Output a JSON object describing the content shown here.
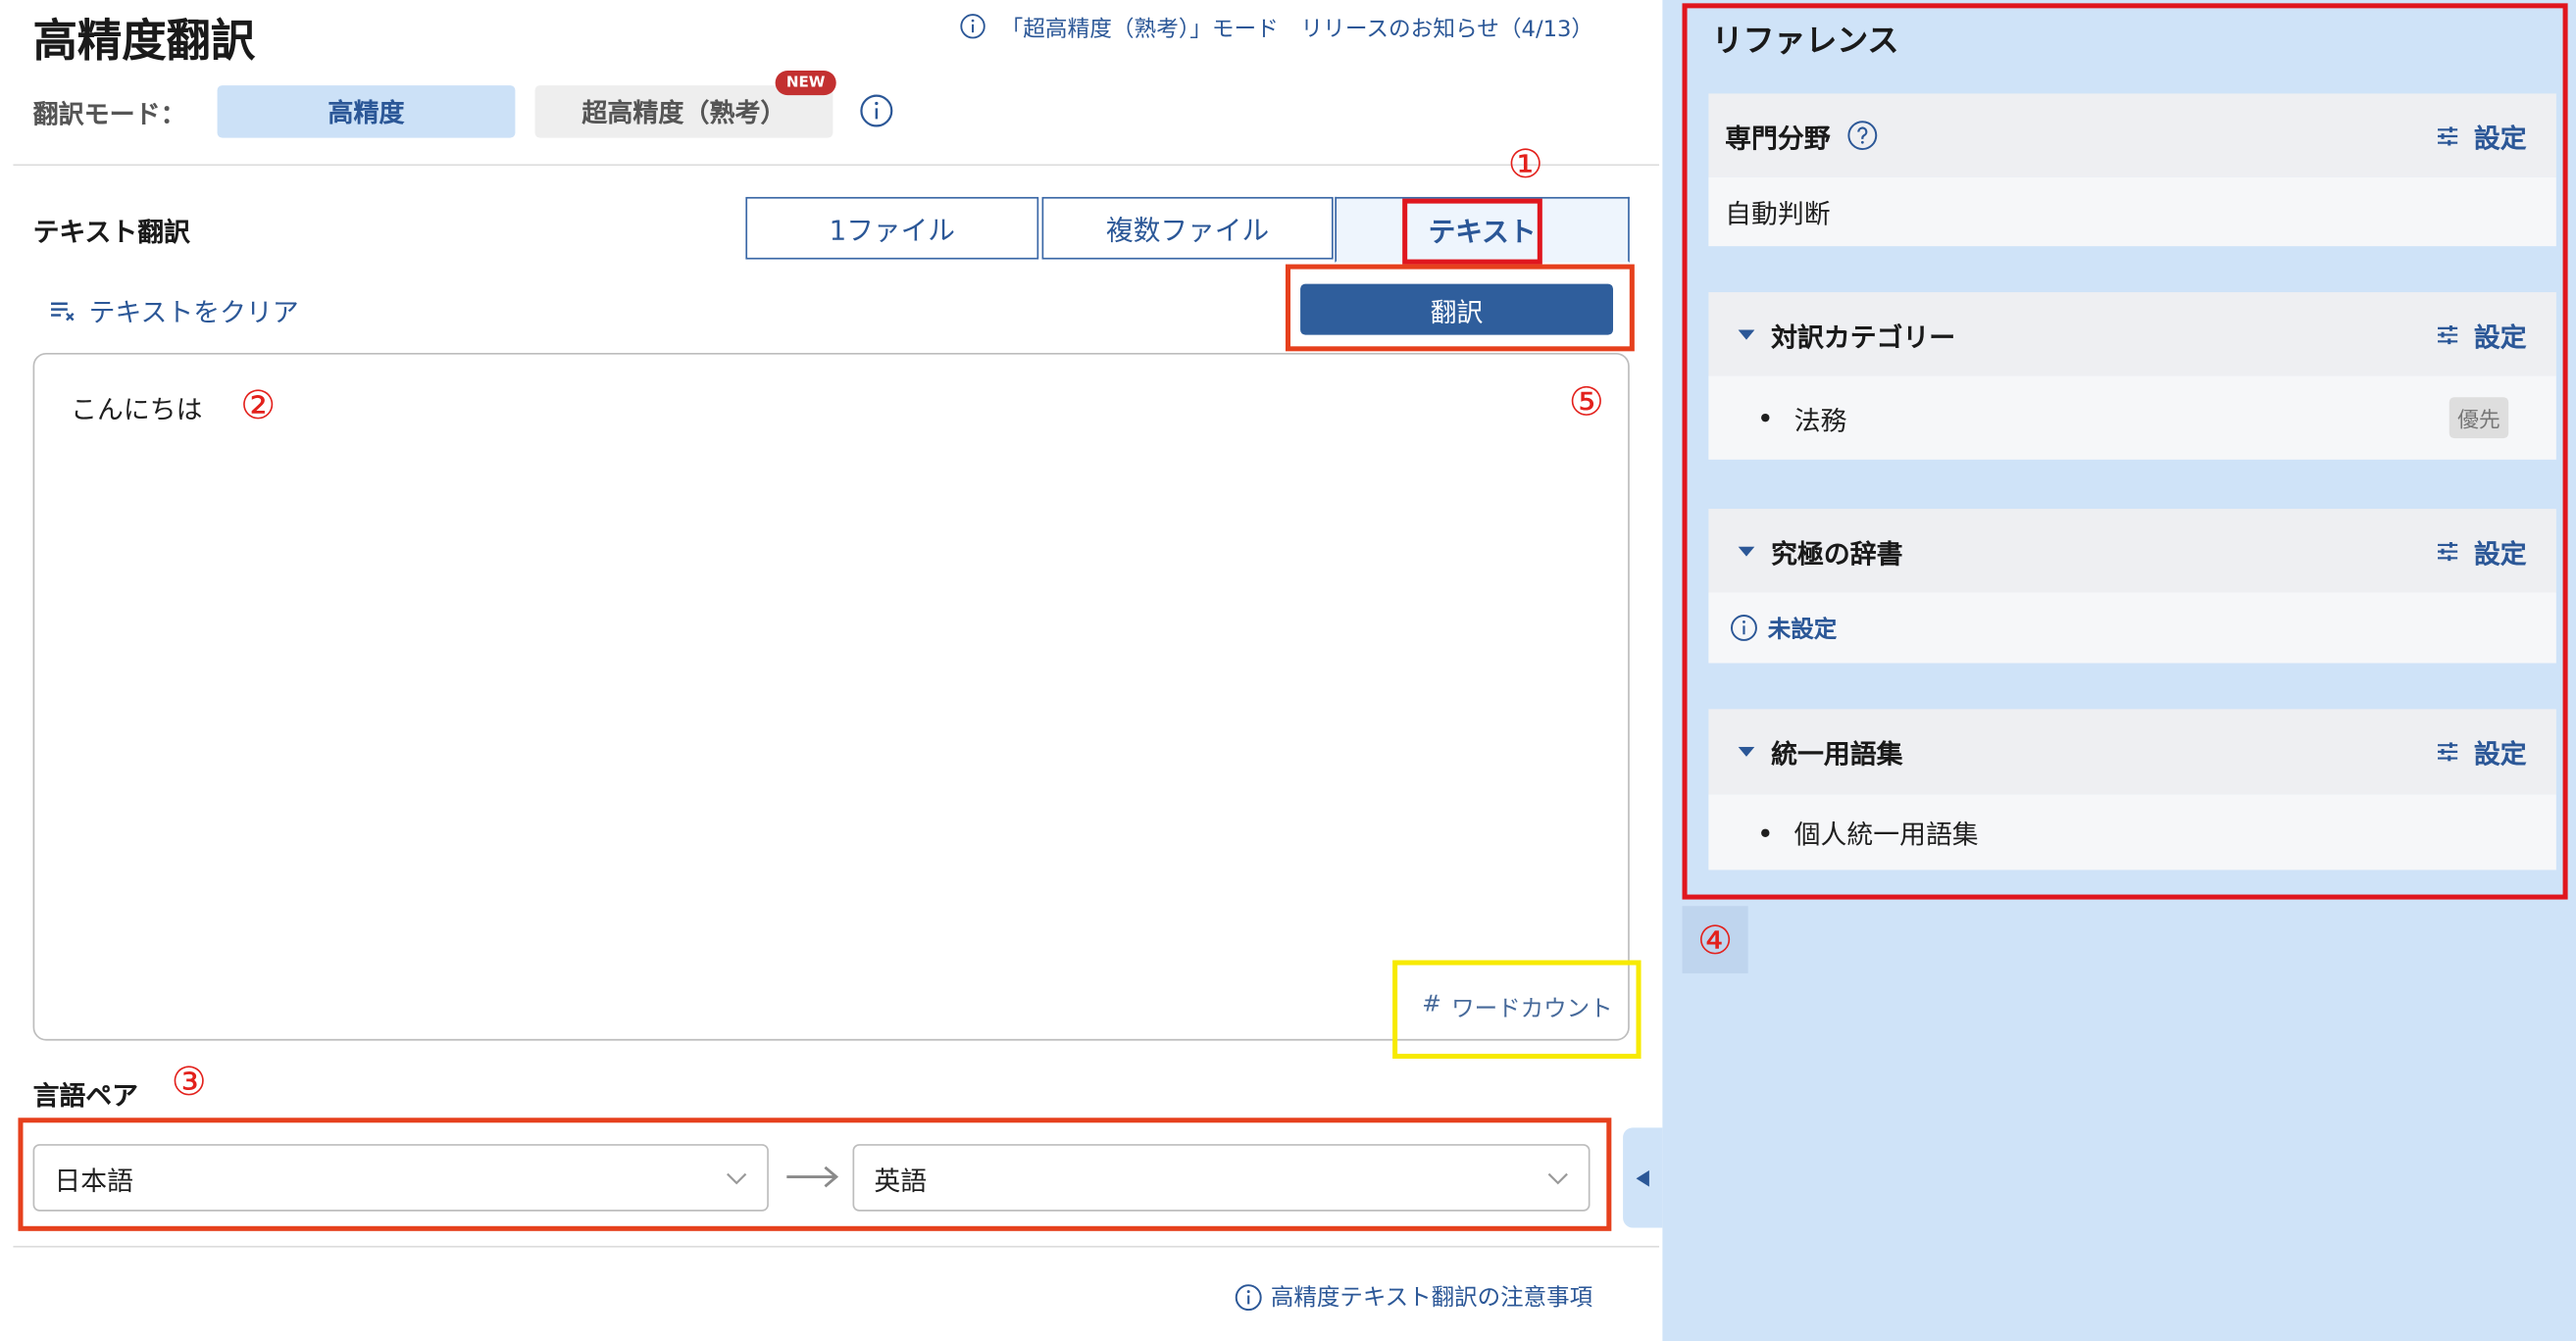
{
  "page": {
    "title": "高精度翻訳"
  },
  "announcement": {
    "icon": "info-icon",
    "text": "「超高精度（熟考）」モード　リリースのお知らせ（4/13）"
  },
  "mode": {
    "label": "翻訳モード：",
    "options": [
      {
        "label": "高精度",
        "selected": true
      },
      {
        "label": "超高精度（熟考）",
        "selected": false,
        "badge": "NEW"
      }
    ],
    "info_icon": "info-icon"
  },
  "text_translation": {
    "heading": "テキスト翻訳",
    "tabs": [
      {
        "label": "1ファイル",
        "selected": false
      },
      {
        "label": "複数ファイル",
        "selected": false
      },
      {
        "label": "テキスト",
        "selected": true
      }
    ],
    "clear_icon": "clear-text-icon",
    "clear_label": "テキストをクリア",
    "translate_label": "翻訳",
    "input_value": "こんにちは",
    "word_count_symbol": "#",
    "word_count_label": "ワードカウント"
  },
  "language_pair": {
    "heading": "言語ペア",
    "source": "日本語",
    "target": "英語",
    "arrow_icon": "arrow-right-icon",
    "dropdown_icon": "chevron-down-icon"
  },
  "footer": {
    "icon": "info-icon",
    "notice_link": "高精度テキスト翻訳の注意事項"
  },
  "reference": {
    "title": "リファレンス",
    "collapse_icon": "triangle-left-icon",
    "sections": [
      {
        "title": "専門分野",
        "help_icon": "question-icon",
        "settings_icon": "sliders-icon",
        "settings_label": "設定",
        "value": "自動判断"
      },
      {
        "title": "対訳カテゴリー",
        "toggle_icon": "caret-down-icon",
        "settings_icon": "sliders-icon",
        "settings_label": "設定",
        "items": [
          {
            "text": "法務",
            "badge": "優先"
          }
        ]
      },
      {
        "title": "究極の辞書",
        "toggle_icon": "caret-down-icon",
        "settings_icon": "sliders-icon",
        "settings_label": "設定",
        "status_icon": "info-icon",
        "status": "未設定"
      },
      {
        "title": "統一用語集",
        "toggle_icon": "caret-down-icon",
        "settings_icon": "sliders-icon",
        "settings_label": "設定",
        "items": [
          {
            "text": "個人統一用語集"
          }
        ]
      }
    ]
  },
  "annotations": {
    "n1": "①",
    "n2": "②",
    "n3": "③",
    "n4": "④",
    "n5": "⑤"
  },
  "colors": {
    "accent": "#2b5797",
    "primary_button": "#2f5e9c",
    "selected_mode_bg": "#cce1f7",
    "reference_panel_bg": "#cfe3f8",
    "new_badge": "#c33030",
    "annotation_red": "#e3211c",
    "annotation_yellow": "#f7ea00"
  }
}
